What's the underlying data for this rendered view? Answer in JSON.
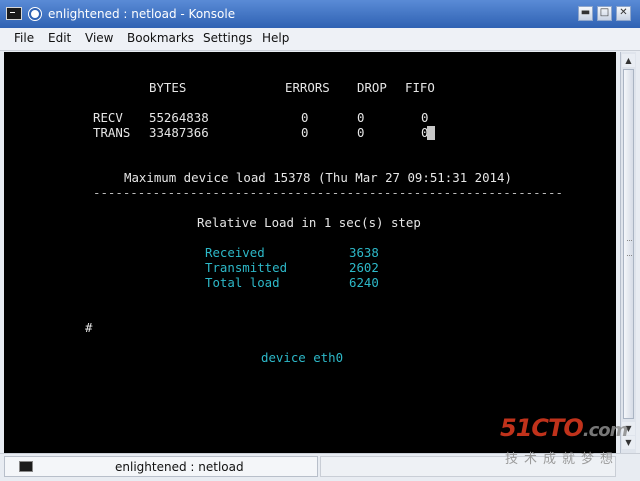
{
  "window": {
    "title": "enlightened : netload - Konsole",
    "controls": {
      "minimize": "▬",
      "maximize": "□",
      "close": "✕"
    }
  },
  "menu": [
    "File",
    "Edit",
    "View",
    "Bookmarks",
    "Settings",
    "Help"
  ],
  "netload": {
    "header": {
      "bytes": "BYTES",
      "errors": "ERRORS",
      "drop": "DROP",
      "fifo": "FIFO"
    },
    "rows": [
      {
        "label": "RECV",
        "bytes": "55264838",
        "errors": "0",
        "drop": "0",
        "fifo": "0"
      },
      {
        "label": "TRANS",
        "bytes": "33487366",
        "errors": "0",
        "drop": "0",
        "fifo": "0"
      }
    ],
    "max_load": "Maximum device load 15378 (Thu Mar 27 09:51:31 2014)",
    "separator": "---------------------------------------------------------------",
    "relative_load": "Relative Load in 1 sec(s) step",
    "stats": [
      {
        "label": "Received",
        "value": "3638"
      },
      {
        "label": "Transmitted",
        "value": "2602"
      },
      {
        "label": "Total load",
        "value": "6240"
      }
    ],
    "prompt": "#",
    "device": "device eth0"
  },
  "tabs": [
    {
      "label": "enlightened : netload"
    }
  ],
  "watermark": {
    "logo_red": "51CTO",
    "logo_gray": ".com",
    "text": "技术成就梦想"
  },
  "colors": {
    "titlebar": "#3a6fc4",
    "terminal_bg": "#000000",
    "cyan": "#2db8c8",
    "watermark_red": "#e23b20"
  }
}
